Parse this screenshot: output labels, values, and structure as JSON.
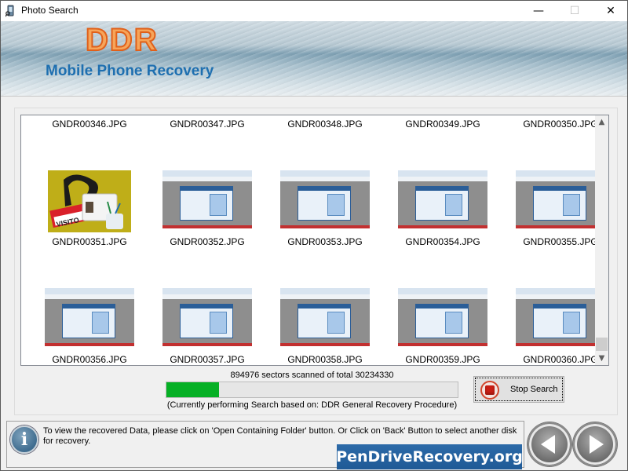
{
  "window": {
    "title": "Photo Search",
    "minimize_glyph": "—",
    "maximize_glyph": "☐",
    "close_glyph": "✕"
  },
  "banner": {
    "logo": "DDR",
    "subtitle": "Mobile Phone Recovery"
  },
  "files": [
    {
      "name": "GNDR00346.JPG",
      "thumb": "none"
    },
    {
      "name": "GNDR00347.JPG",
      "thumb": "none"
    },
    {
      "name": "GNDR00348.JPG",
      "thumb": "none"
    },
    {
      "name": "GNDR00349.JPG",
      "thumb": "none"
    },
    {
      "name": "GNDR00350.JPG",
      "thumb": "none"
    },
    {
      "name": "GNDR00351.JPG",
      "thumb": "visitor-badge"
    },
    {
      "name": "GNDR00352.JPG",
      "thumb": "app-screenshot"
    },
    {
      "name": "GNDR00353.JPG",
      "thumb": "app-screenshot"
    },
    {
      "name": "GNDR00354.JPG",
      "thumb": "app-screenshot"
    },
    {
      "name": "GNDR00355.JPG",
      "thumb": "app-screenshot"
    },
    {
      "name": "GNDR00356.JPG",
      "thumb": "app-screenshot"
    },
    {
      "name": "GNDR00357.JPG",
      "thumb": "app-screenshot"
    },
    {
      "name": "GNDR00358.JPG",
      "thumb": "app-screenshot"
    },
    {
      "name": "GNDR00359.JPG",
      "thumb": "app-screenshot"
    },
    {
      "name": "GNDR00360.JPG",
      "thumb": "app-screenshot"
    }
  ],
  "scan": {
    "status_text": "894976 sectors scanned of total 30234330",
    "sectors_scanned": 894976,
    "sectors_total": 30234330,
    "progress_fraction_shown": 0.18,
    "procedure_text": "(Currently performing Search based on:  DDR General Recovery Procedure)"
  },
  "buttons": {
    "stop_search": "Stop Search",
    "back": "Back",
    "next": "Next"
  },
  "info": {
    "icon": "i",
    "message": "To view the recovered Data, please click on 'Open Containing Folder' button. Or Click on 'Back' Button to select another disk for recovery."
  },
  "brand": {
    "text": "PenDriveRecovery.org"
  },
  "colors": {
    "progress_green": "#06b025",
    "logo_orange": "#f6a55a",
    "subtitle_blue": "#1e6fb0",
    "brand_blue": "#2c6aa8",
    "stop_red": "#c81e14"
  }
}
